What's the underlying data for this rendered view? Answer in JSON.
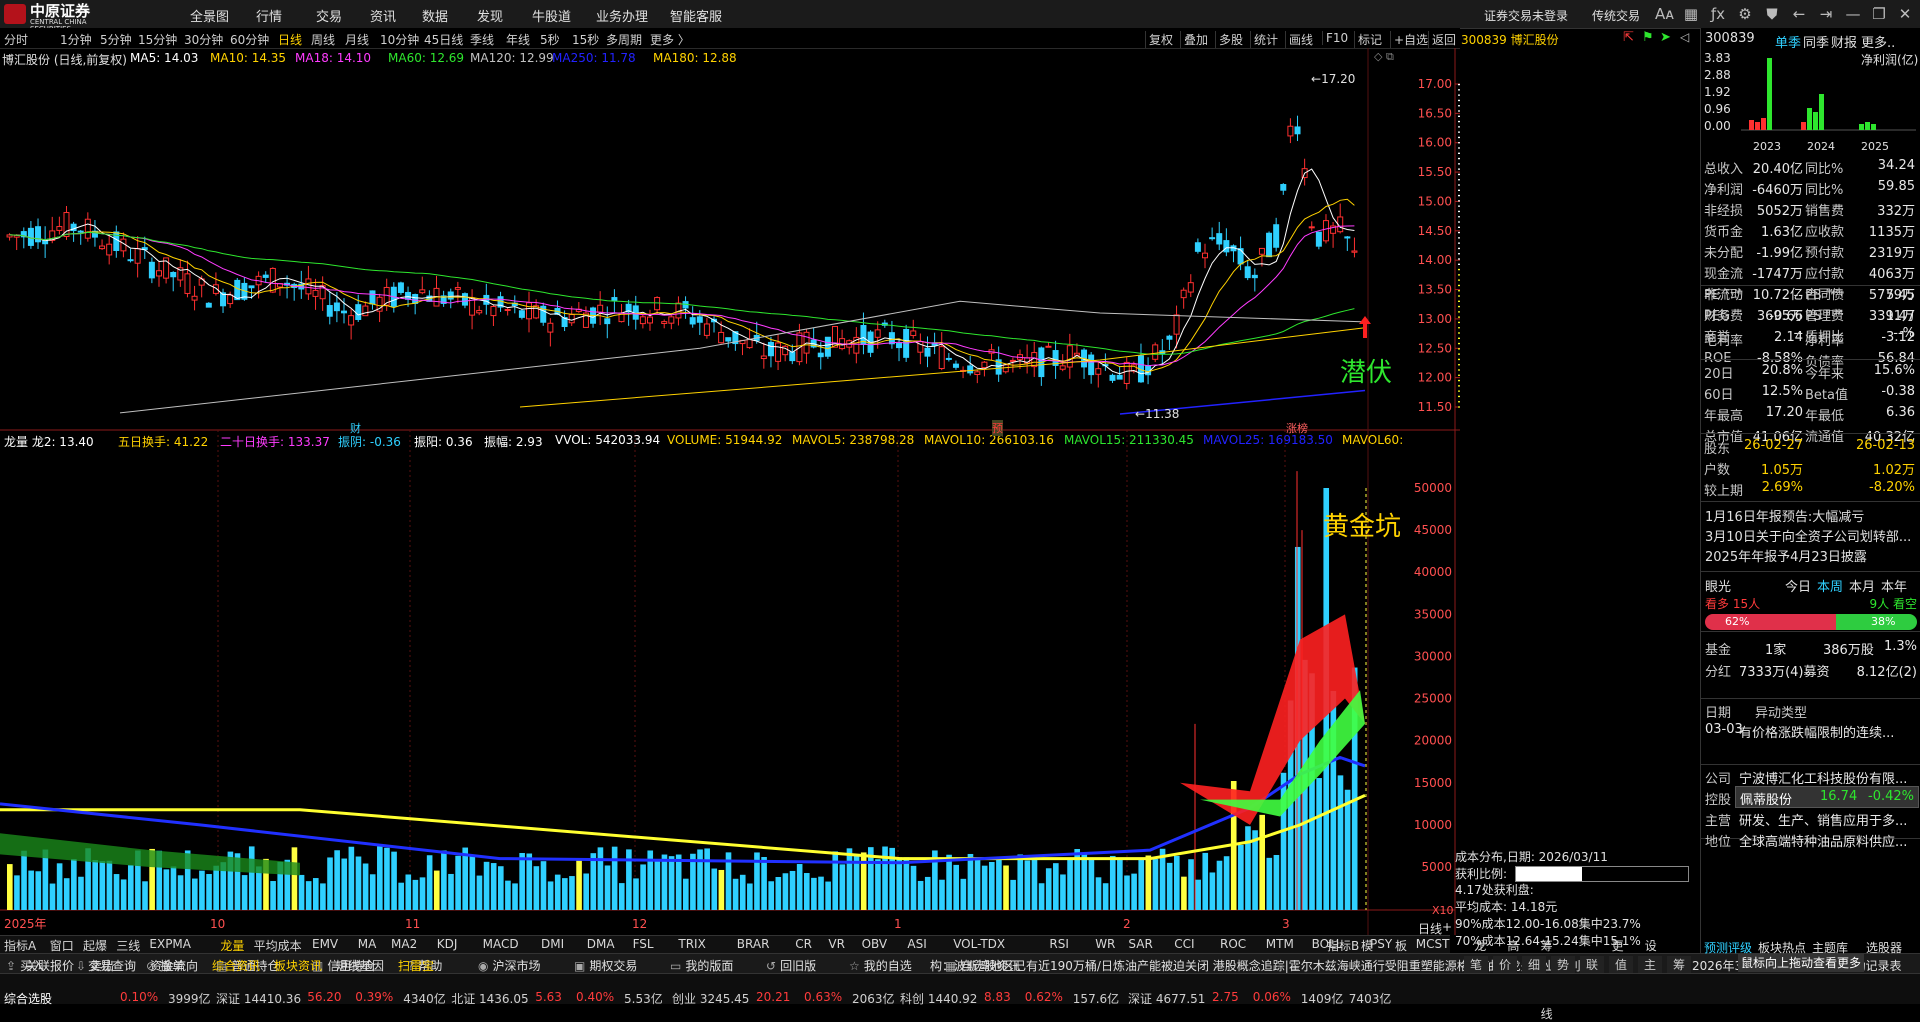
{
  "app": {
    "logo_name": "中原证券",
    "logo_sub": "CENTRAL CHINA SECURITIES",
    "menu": [
      "全景图",
      "行情",
      "交易",
      "资讯",
      "数据",
      "发现",
      "牛股道",
      "业务办理",
      "智能客服"
    ],
    "right_menu": [
      "证券交易未登录",
      "传统交易"
    ],
    "title_icons": [
      "font-size-icon",
      "grid-icon",
      "formula-icon",
      "gear-icon",
      "shirt-icon",
      "back-icon",
      "minimize-icon",
      "restore-icon",
      "close-icon"
    ]
  },
  "periods": [
    "分时",
    "1分钟",
    "5分钟",
    "15分钟",
    "30分钟",
    "60分钟",
    "日线",
    "周线",
    "月线",
    "10分钟",
    "45日线",
    "季线",
    "年线",
    "5秒",
    "15秒",
    "多周期",
    "更多 〉"
  ],
  "active_period": "日线",
  "chart_tools": [
    "复权",
    "叠加",
    "多股",
    "统计",
    "画线",
    "F10",
    "标记",
    "+自选",
    "返回"
  ],
  "stock": {
    "code": "300839",
    "name": "博汇股份",
    "header": "300839 博汇股份",
    "chart_title": "博汇股份 (日线,前复权)"
  },
  "ma_legend": [
    {
      "label": "MA5: 14.03",
      "color": "#ffffff"
    },
    {
      "label": "MA10: 14.35",
      "color": "#ffd200"
    },
    {
      "label": "MA18: 14.10",
      "color": "#ff3cff"
    },
    {
      "label": "MA60: 12.69",
      "color": "#2ee62e"
    },
    {
      "label": "MA120: 12.99",
      "color": "#c0c0c0"
    },
    {
      "label": "MA250: 11.78",
      "color": "#2222ff"
    },
    {
      "label": "MA180: 12.88",
      "color": "#ffd200"
    }
  ],
  "ind_legend": [
    {
      "label": "龙量 龙2: 13.40",
      "color": "#ffffff"
    },
    {
      "label": "五日换手: 41.22",
      "color": "#ffd200"
    },
    {
      "label": "二十日换手: 133.37",
      "color": "#ff3cff"
    },
    {
      "label": "振阴: -0.36",
      "color": "#2fd0ff"
    },
    {
      "label": "振阳: 0.36",
      "color": "#ffffff"
    },
    {
      "label": "振幅: 2.93",
      "color": "#ffffff"
    },
    {
      "label": "VVOL: 542033.94",
      "color": "#ffffff"
    },
    {
      "label": "VOLUME: 51944.92",
      "color": "#ffd200"
    },
    {
      "label": "MAVOL5: 238798.28",
      "color": "#ffd200"
    },
    {
      "label": "MAVOL10: 266103.16",
      "color": "#ffd200"
    },
    {
      "label": "MAVOL15: 211330.45",
      "color": "#2ee62e"
    },
    {
      "label": "MAVOL25: 169183.50",
      "color": "#2222ff"
    },
    {
      "label": "MAVOL60:",
      "color": "#ffd200"
    }
  ],
  "price_axis": [
    "17.00",
    "16.50",
    "16.00",
    "15.50",
    "15.00",
    "14.50",
    "14.00",
    "13.50",
    "13.00",
    "12.50",
    "12.00",
    "11.50"
  ],
  "vol_axis": [
    "50000",
    "45000",
    "40000",
    "35000",
    "30000",
    "25000",
    "20000",
    "15000",
    "10000",
    "5000"
  ],
  "x_labels": [
    "2025年",
    "10",
    "11",
    "12",
    "1",
    "2",
    "3"
  ],
  "vol_unit": "X10",
  "annotations": {
    "high": "17.20",
    "low": "11.38",
    "qianfu": "潜伏",
    "huangjinkeng": "黄金坑",
    "marker_cai": "财",
    "marker_yu": "预",
    "marker_zhangting": "涨榜"
  },
  "chip_dist": {
    "title": "成本分布,日期: 2026/03/11",
    "profit_label": "获利比例:",
    "profit_pct": "39.0%",
    "profit_fraction": 0.39,
    "profit_line": "4.17处获利盘:",
    "avg_cost": "平均成本: 14.18元",
    "range90": "90%成本12.00-16.08集中23.7%",
    "range70": "70%成本12.64-15.24集中15.1%"
  },
  "right_panel": {
    "code": "300839",
    "tabs": [
      "单季",
      "同季",
      "财报",
      "更多.."
    ],
    "profit_title": "净利润(亿)",
    "profit_y": [
      "3.83",
      "2.88",
      "1.92",
      "0.96",
      "0.00"
    ],
    "profit_years": [
      "2023",
      "2024",
      "2025"
    ],
    "rows": [
      {
        "k": "总收入",
        "v1": "20.40亿",
        "k2": "同比%",
        "v2": "34.24"
      },
      {
        "k": "净利润",
        "v1": "-6460万",
        "k2": "同比%",
        "v2": "59.85"
      },
      {
        "k": "非经损",
        "v1": "5052万",
        "k2": "销售费",
        "v2": "332万"
      },
      {
        "k": "货币金",
        "v1": "1.63亿",
        "k2": "应收款",
        "v2": "1135万"
      },
      {
        "k": "未分配",
        "v1": "-1.99亿",
        "k2": "预付款",
        "v2": "2319万"
      },
      {
        "k": "现金流",
        "v1": "-1747万",
        "k2": "应付款",
        "v2": "4063万"
      },
      {
        "k": "非流动",
        "v1": "10.72亿",
        "k2": "合同债",
        "v2": "5779万"
      },
      {
        "k": "财务费",
        "v1": "3695万",
        "k2": "管理费",
        "v2": "3391万"
      },
      {
        "k": "商誉",
        "v1": "--",
        "k2": "质押比",
        "v2": "--%"
      }
    ],
    "val_rows": [
      {
        "k": "PE ᵀᵀᴹ",
        "v1": "--",
        "k2": "PB ᴹᴿᵠ",
        "v2": "5.45"
      },
      {
        "k": "PEG",
        "v1": "-0.66",
        "k2": "PS ᵀᵀᴹ",
        "v2": "1.47"
      },
      {
        "k": "毛利率",
        "v1": "2.14",
        "k2": "净利率",
        "v2": "-3.12"
      },
      {
        "k": "ROE",
        "v1": "-8.58%",
        "k2": "负债率",
        "v2": "56.84"
      }
    ],
    "perf_rows": [
      {
        "k": "20日",
        "v1": "20.8%",
        "k2": "今年来",
        "v2": "15.6%"
      },
      {
        "k": "60日",
        "v1": "12.5%",
        "k2": "Beta值",
        "v2": "-0.38"
      },
      {
        "k": "年最高",
        "v1": "17.20",
        "k2": "年最低",
        "v2": "6.36"
      },
      {
        "k": "总市值",
        "v1": "41.06亿",
        "k2": "流通值",
        "v2": "40.32亿"
      }
    ],
    "holder_rows": [
      {
        "k": "股东",
        "v1": "26-02-27",
        "k2": "",
        "v2": "26-02-13"
      },
      {
        "k": "户数",
        "v1": "1.05万",
        "k2": "",
        "v2": "1.02万"
      },
      {
        "k": "较上期",
        "v1": "2.69%",
        "k2": "",
        "v2": "-8.20%"
      }
    ],
    "news": [
      "1月16日年报预告:大幅减亏",
      "3月10日关于向全资子公司划转部...",
      "2025年年报予4月23日披露"
    ],
    "eyelight": {
      "label": "眼光",
      "tabs": [
        "今日",
        "本周",
        "本月",
        "本年"
      ],
      "bull": "看多 15人",
      "bear": "9人 看空",
      "bull_pct": "62%",
      "bear_pct": "38%",
      "bull_fraction": 0.62
    },
    "fund": {
      "k": "基金",
      "v1": "1家",
      "v2": "386万股",
      "v3": "1.3%"
    },
    "dividend": {
      "k": "分红",
      "v1": "7333万(4)募资",
      "v2": "8.12亿(2)"
    },
    "anomaly": {
      "k": "日期",
      "v": "异动类型",
      "date": "03-03",
      "text": "有价格涨跌幅限制的连续..."
    },
    "company": [
      {
        "k": "公司",
        "v": "宁波博汇化工科技股份有限..."
      },
      {
        "k": "控股",
        "v": "文..."
      },
      {
        "k": "主营",
        "v": "研发、生产、销售应用于多..."
      },
      {
        "k": "地位",
        "v": "全球高端特种油品原料供应..."
      }
    ],
    "popup": {
      "name": "佩蒂股份",
      "price": "16.74",
      "change": "-0.42%"
    },
    "small_tabs": [
      "笔",
      "价",
      "细",
      "势",
      "联",
      "值",
      "主",
      "筹"
    ],
    "tip": "鼠标向上拖动查看更多",
    "bottom_tabs": [
      "预测评级",
      "板块热点",
      "主题库",
      "选股器"
    ]
  },
  "indicator_tabs": [
    "指标A",
    "窗口",
    "起爆",
    "三线",
    "EXPMA",
    "龙量",
    "平均成本",
    "EMV",
    "MA",
    "MA2",
    "KDJ",
    "MACD",
    "DMI",
    "DMA",
    "FSL",
    "TRIX",
    "BRAR",
    "CR",
    "VR",
    "OBV",
    "ASI",
    "VOL-TDX",
    "RSI",
    "WR",
    "SAR",
    "CCI",
    "ROC",
    "MTM",
    "BOLL",
    "PSY",
    "MCST",
    "龙线",
    "高低",
    "筹码散户线",
    "更多",
    "设置"
  ],
  "indicator_right": [
    "指标B",
    "模",
    "板"
  ],
  "bottom_right_tabs": [
    "日线",
    "+"
  ],
  "function_bar": [
    {
      "icon": "buy-icon",
      "label": "买入"
    },
    {
      "icon": "sell-icon",
      "label": "卖出"
    },
    {
      "icon": "cancel-icon",
      "label": "撤单"
    },
    {
      "icon": "holdings-icon",
      "label": "普通持仓"
    },
    {
      "icon": "credit-icon",
      "label": "信用持仓"
    },
    {
      "icon": "help-icon",
      "label": "帮助"
    },
    {
      "icon": "hk-icon",
      "label": "沪深市场"
    },
    {
      "icon": "futures-icon",
      "label": "期权交易"
    },
    {
      "icon": "layout-icon",
      "label": "我的版面"
    },
    {
      "icon": "rewind-icon",
      "label": "回旧版"
    },
    {
      "icon": "star-icon",
      "label": "我的自选"
    },
    {
      "icon": "quote-icon",
      "label": "自选股资讯"
    }
  ],
  "ticker_text": "构：波斯湾地区已有近190万桶/日炼油产能被迫关闭    港股概念追踪|霍尔木兹海峡通行受阻重塑能源格局 油运龙头企业盈利",
  "ticker_right": "2026年3月10日投资者关系活动记录表",
  "left_links": [
    "关联报价",
    "交易查询",
    "资金流向",
    "综合资讯",
    "板块资讯",
    "短线基因",
    "扫雷宝"
  ],
  "status_bar": {
    "label": "综合选股",
    "items": [
      "0.10%",
      "3999亿",
      "深证 14410.36",
      "56.20",
      "0.39%",
      "4340亿",
      "北证 1436.05",
      "5.63",
      "0.40%",
      "5.53亿",
      "创业 3245.45",
      "20.21",
      "0.63%",
      "2063亿",
      "科创 1440.92",
      "8.83",
      "0.62%",
      "157.6亿",
      "深证 4677.51",
      "2.75",
      "0.06%",
      "1409亿",
      "7403亿"
    ]
  }
}
